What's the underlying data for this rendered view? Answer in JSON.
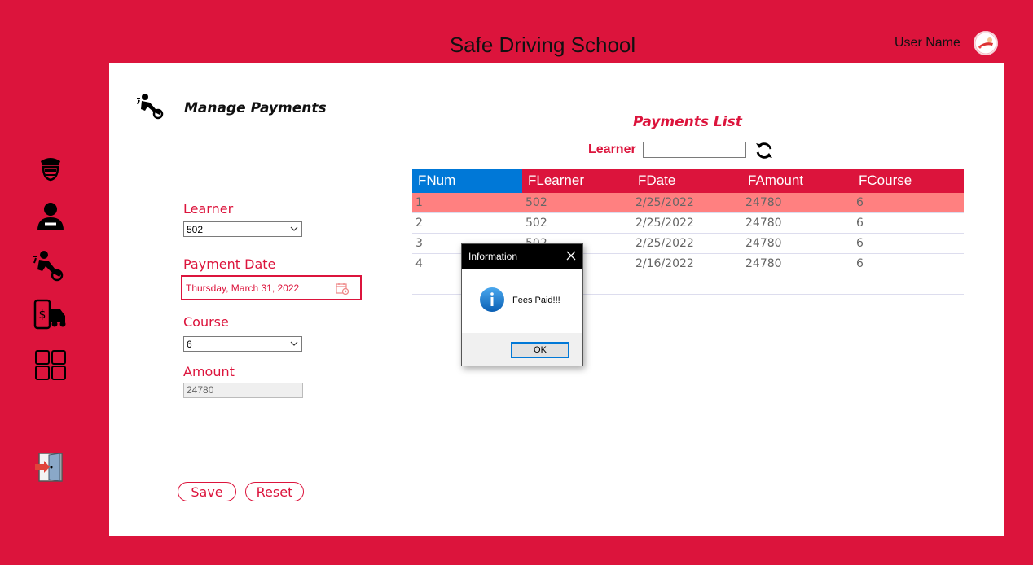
{
  "header": {
    "app_title": "Safe Driving School",
    "user_name": "User Name"
  },
  "page": {
    "title": "Manage Payments"
  },
  "form": {
    "learner_label": "Learner",
    "learner_value": "502",
    "payment_date_label": "Payment Date",
    "payment_date_value": "Thursday, March 31, 2022",
    "course_label": "Course",
    "course_value": "6",
    "amount_label": "Amount",
    "amount_value": "24780",
    "save_label": "Save",
    "reset_label": "Reset"
  },
  "list": {
    "title": "Payments List",
    "filter_label": "Learner",
    "filter_value": "",
    "columns": [
      "FNum",
      "FLearner",
      "FDate",
      "FAmount",
      "FCourse"
    ],
    "rows": [
      [
        "1",
        "502",
        "2/25/2022",
        "24780",
        "6"
      ],
      [
        "2",
        "502",
        "2/25/2022",
        "24780",
        "6"
      ],
      [
        "3",
        "502",
        "2/25/2022",
        "24780",
        "6"
      ],
      [
        "4",
        "",
        "2/16/2022",
        "24780",
        "6"
      ]
    ]
  },
  "dialog": {
    "title": "Information",
    "message": "Fees Paid!!!",
    "ok_label": "OK"
  },
  "colors": {
    "accent": "#DC143C",
    "selected_row": "#FF8080",
    "header_first": "#0078D7"
  }
}
